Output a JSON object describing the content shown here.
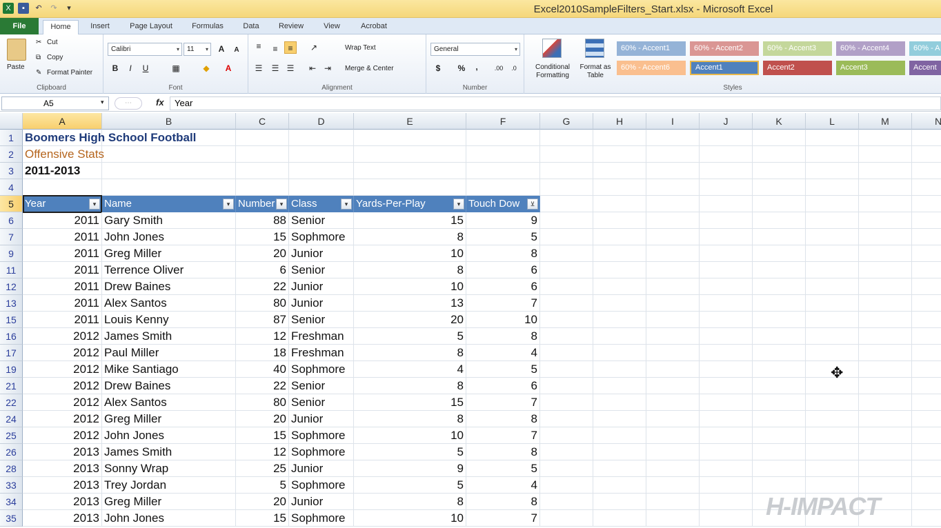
{
  "window": {
    "title": "Excel2010SampleFilters_Start.xlsx - Microsoft Excel"
  },
  "tabs": [
    "File",
    "Home",
    "Insert",
    "Page Layout",
    "Formulas",
    "Data",
    "Review",
    "View",
    "Acrobat"
  ],
  "clipboard": {
    "paste": "Paste",
    "cut": "Cut",
    "copy": "Copy",
    "format_painter": "Format Painter",
    "label": "Clipboard"
  },
  "font": {
    "name": "Calibri",
    "size": "11",
    "label": "Font",
    "bold": "B",
    "italic": "I",
    "underline": "U",
    "grow": "A",
    "shrink": "A"
  },
  "alignment": {
    "wrap": "Wrap Text",
    "merge": "Merge & Center",
    "label": "Alignment"
  },
  "number": {
    "format": "General",
    "currency": "$",
    "percent": "%",
    "comma": ",",
    "label": "Number"
  },
  "styles": {
    "conditional": "Conditional Formatting",
    "format_table": "Format as Table",
    "label": "Styles",
    "cells": [
      {
        "label": "60% - Accent1",
        "color": "#95b3d7"
      },
      {
        "label": "60% - Accent2",
        "color": "#da9694"
      },
      {
        "label": "60% - Accent3",
        "color": "#c4d79b"
      },
      {
        "label": "60% - Accent4",
        "color": "#b1a0c7"
      },
      {
        "label": "60% - A",
        "color": "#92cddc"
      },
      {
        "label": "60% - Accent6",
        "color": "#fabf8f"
      },
      {
        "label": "Accent1",
        "color": "#4f81bd"
      },
      {
        "label": "Accent2",
        "color": "#c0504d"
      },
      {
        "label": "Accent3",
        "color": "#9bbb59"
      },
      {
        "label": "Accent",
        "color": "#8064a2"
      }
    ]
  },
  "formula": {
    "name_box": "A5",
    "fx": "fx",
    "value": "Year"
  },
  "columns": [
    "A",
    "B",
    "C",
    "D",
    "E",
    "F",
    "G",
    "H",
    "I",
    "J",
    "K",
    "L",
    "M",
    "N"
  ],
  "sheet": {
    "title": "Boomers High School Football",
    "subtitle": "Offensive Stats",
    "years": "2011-2013",
    "headers": [
      "Year",
      "Name",
      "Number",
      "Class",
      "Yards-Per-Play",
      "Touch Dow"
    ],
    "rows": [
      {
        "r": "6",
        "year": "2011",
        "name": "Gary Smith",
        "num": "88",
        "cls": "Senior",
        "ypp": "15",
        "td": "9"
      },
      {
        "r": "7",
        "year": "2011",
        "name": "John Jones",
        "num": "15",
        "cls": "Sophmore",
        "ypp": "8",
        "td": "5"
      },
      {
        "r": "9",
        "year": "2011",
        "name": "Greg Miller",
        "num": "20",
        "cls": "Junior",
        "ypp": "10",
        "td": "8"
      },
      {
        "r": "11",
        "year": "2011",
        "name": "Terrence Oliver",
        "num": "6",
        "cls": "Senior",
        "ypp": "8",
        "td": "6"
      },
      {
        "r": "12",
        "year": "2011",
        "name": "Drew Baines",
        "num": "22",
        "cls": "Junior",
        "ypp": "10",
        "td": "6"
      },
      {
        "r": "13",
        "year": "2011",
        "name": "Alex Santos",
        "num": "80",
        "cls": "Junior",
        "ypp": "13",
        "td": "7"
      },
      {
        "r": "15",
        "year": "2011",
        "name": "Louis Kenny",
        "num": "87",
        "cls": "Senior",
        "ypp": "20",
        "td": "10"
      },
      {
        "r": "16",
        "year": "2012",
        "name": "James Smith",
        "num": "12",
        "cls": "Freshman",
        "ypp": "5",
        "td": "8"
      },
      {
        "r": "17",
        "year": "2012",
        "name": "Paul Miller",
        "num": "18",
        "cls": "Freshman",
        "ypp": "8",
        "td": "4"
      },
      {
        "r": "19",
        "year": "2012",
        "name": "Mike Santiago",
        "num": "40",
        "cls": "Sophmore",
        "ypp": "4",
        "td": "5"
      },
      {
        "r": "21",
        "year": "2012",
        "name": "Drew Baines",
        "num": "22",
        "cls": "Senior",
        "ypp": "8",
        "td": "6"
      },
      {
        "r": "22",
        "year": "2012",
        "name": "Alex Santos",
        "num": "80",
        "cls": "Senior",
        "ypp": "15",
        "td": "7"
      },
      {
        "r": "24",
        "year": "2012",
        "name": "Greg Miller",
        "num": "20",
        "cls": "Junior",
        "ypp": "8",
        "td": "8"
      },
      {
        "r": "25",
        "year": "2012",
        "name": "John Jones",
        "num": "15",
        "cls": "Sophmore",
        "ypp": "10",
        "td": "7"
      },
      {
        "r": "26",
        "year": "2013",
        "name": "James Smith",
        "num": "12",
        "cls": "Sophmore",
        "ypp": "5",
        "td": "8"
      },
      {
        "r": "28",
        "year": "2013",
        "name": "Sonny Wrap",
        "num": "25",
        "cls": "Junior",
        "ypp": "9",
        "td": "5"
      },
      {
        "r": "33",
        "year": "2013",
        "name": "Trey Jordan",
        "num": "5",
        "cls": "Sophmore",
        "ypp": "5",
        "td": "4"
      },
      {
        "r": "34",
        "year": "2013",
        "name": "Greg Miller",
        "num": "20",
        "cls": "Junior",
        "ypp": "8",
        "td": "8"
      },
      {
        "r": "35",
        "year": "2013",
        "name": "John Jones",
        "num": "15",
        "cls": "Sophmore",
        "ypp": "10",
        "td": "7"
      }
    ]
  },
  "watermark": "H-IMPACT"
}
